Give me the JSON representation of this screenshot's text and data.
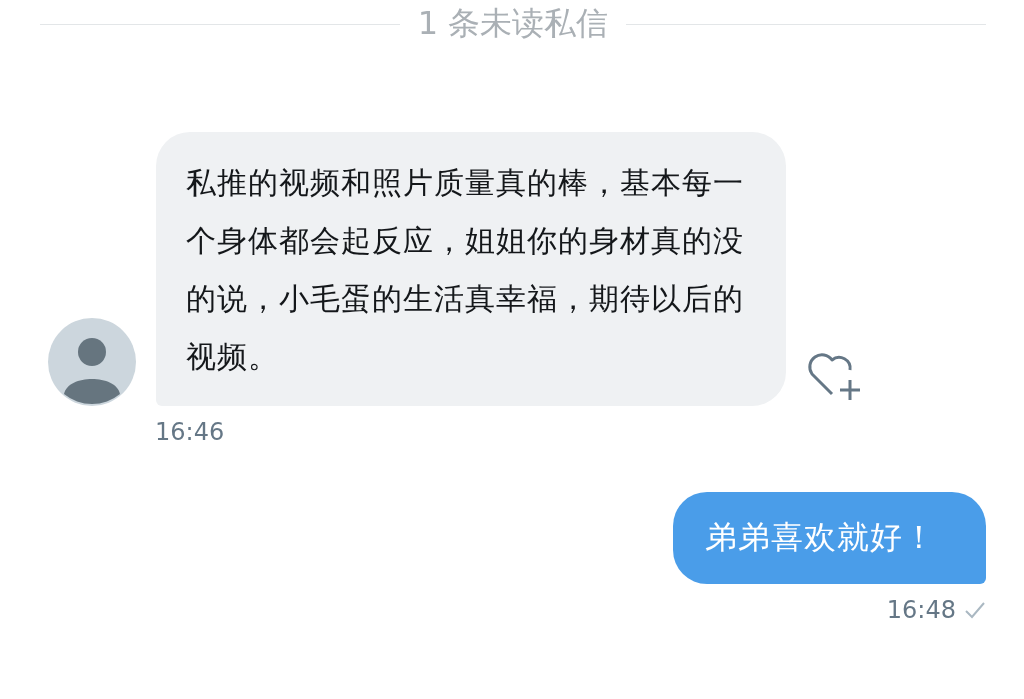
{
  "divider": {
    "label": "1 条未读私信"
  },
  "messages": [
    {
      "kind": "incoming",
      "text": "私推的视频和照片质量真的棒，基本每一个身体都会起反应，姐姐你的身材真的没的说，小毛蛋的生活真幸福，期待以后的视频。",
      "time": "16:46"
    },
    {
      "kind": "outgoing",
      "text": "弟弟喜欢就好！",
      "time": "16:48",
      "seen": true
    }
  ]
}
